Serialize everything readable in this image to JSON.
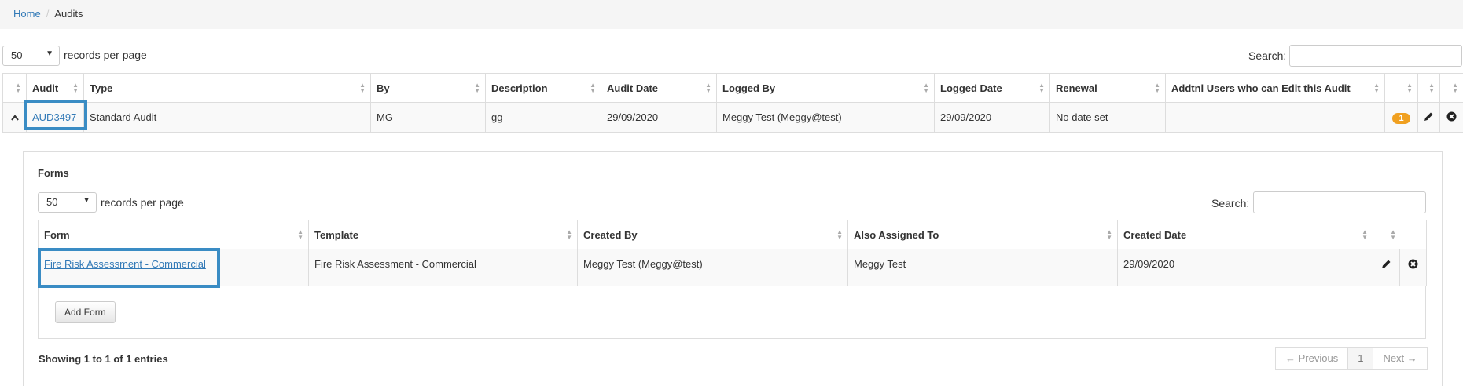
{
  "breadcrumb": {
    "home": "Home",
    "separator": "/",
    "current": "Audits"
  },
  "top_controls": {
    "page_size": "50",
    "records_label": "records per page",
    "search_label": "Search:",
    "search_value": ""
  },
  "audits_table": {
    "headers": [
      "Audit",
      "Type",
      "By",
      "Description",
      "Audit Date",
      "Logged By",
      "Logged Date",
      "Renewal",
      "Addtnl Users who can Edit this Audit"
    ],
    "row": {
      "expand_icon": "chevron-up-icon",
      "audit": "AUD3497",
      "type": "Standard Audit",
      "by": "MG",
      "description": "gg",
      "audit_date": "29/09/2020",
      "logged_by": "Meggy Test (Meggy@test)",
      "logged_date": "29/09/2020",
      "renewal": "No date set",
      "addtnl_users": "",
      "badge": "1",
      "edit_icon": "pencil-icon",
      "delete_icon": "close-circle-icon"
    }
  },
  "forms": {
    "title": "Forms",
    "page_size": "50",
    "records_label": "records per page",
    "search_label": "Search:",
    "search_value": "",
    "headers": [
      "Form",
      "Template",
      "Created By",
      "Also Assigned To",
      "Created Date"
    ],
    "row": {
      "form": "Fire Risk Assessment - Commercial",
      "template": "Fire Risk Assessment - Commercial",
      "created_by": "Meggy Test (Meggy@test)",
      "also_assigned": "Meggy Test",
      "created_date": "29/09/2020",
      "edit_icon": "pencil-icon",
      "delete_icon": "close-circle-icon"
    },
    "add_button": "Add Form",
    "info": "Showing 1 to 1 of 1 entries",
    "pager": {
      "previous": "← Previous",
      "page": "1",
      "next": "Next →"
    }
  },
  "colors": {
    "link": "#337ab7",
    "highlight": "#3a8cc4",
    "badge": "#f0a020"
  }
}
